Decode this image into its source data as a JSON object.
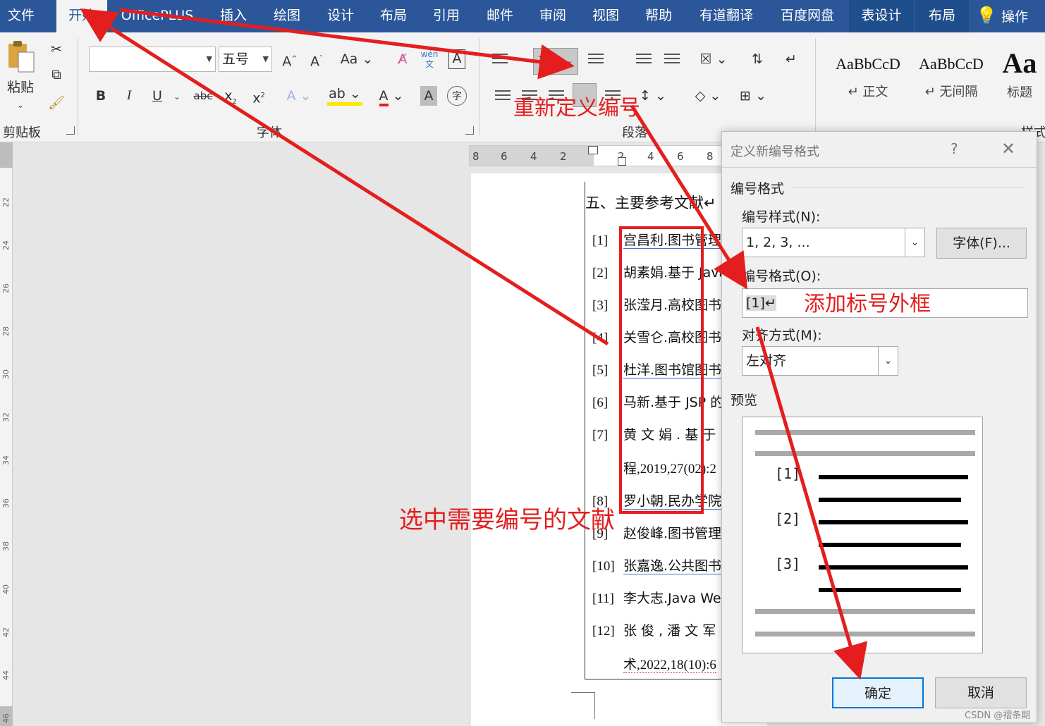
{
  "ribbon_tabs": [
    "文件",
    "开始",
    "OfficePLUS",
    "插入",
    "绘图",
    "设计",
    "布局",
    "引用",
    "邮件",
    "审阅",
    "视图",
    "帮助",
    "有道翻译",
    "百度网盘",
    "表设计",
    "布局",
    "操作"
  ],
  "clipboard": {
    "paste_label": "粘贴",
    "group_label": "剪贴板"
  },
  "font": {
    "font_name": "",
    "font_size": "五号",
    "group_label": "字体"
  },
  "paragraph": {
    "group_label": "段落"
  },
  "styles": {
    "items": [
      {
        "sample": "AaBbCcD",
        "name": "↵ 正文"
      },
      {
        "sample": "AaBbCcD",
        "name": "↵ 无间隔"
      },
      {
        "sample": "Aa",
        "name": "标题"
      }
    ],
    "group_label": "样式"
  },
  "vertical_ruler_ticks": [
    "22",
    "24",
    "26",
    "28",
    "30",
    "32",
    "34",
    "36",
    "38",
    "40",
    "42",
    "44",
    "46"
  ],
  "horizontal_ruler_ticks": [
    "8",
    "6",
    "4",
    "2",
    "2",
    "4",
    "6",
    "8"
  ],
  "document": {
    "heading": "五、主要参考文献↵",
    "references": [
      {
        "num": "[1]",
        "text": "宫昌利.图书管理"
      },
      {
        "num": "[2]",
        "text": "胡素娟.基于 Java"
      },
      {
        "num": "[3]",
        "text": "张滢月.高校图书"
      },
      {
        "num": "[4]",
        "text": "关雪仑.高校图书"
      },
      {
        "num": "[5]",
        "text": "杜洋.图书馆图书"
      },
      {
        "num": "[6]",
        "text": "马新.基于 JSP 的"
      },
      {
        "num": "[7]",
        "text": "黄 文 娟 . 基 于"
      },
      {
        "num": "[8]",
        "text": "罗小朝.民办学院"
      },
      {
        "num": "[9]",
        "text": "赵俊峰.图书管理"
      },
      {
        "num": "[10]",
        "text": "张嘉逸.公共图书"
      },
      {
        "num": "[11]",
        "text": "李大志.Java Web"
      },
      {
        "num": "[12]",
        "text": "张 俊 , 潘 文 军"
      }
    ],
    "continuation_7": "程,2019,27(02):2",
    "continuation_12": "术,2022,18(10):6"
  },
  "dialog": {
    "title": "定义新编号格式",
    "help": "?",
    "close": "✕",
    "section_label": "编号格式",
    "style_label": "编号样式(N):",
    "style_value": "1, 2, 3, ...",
    "font_button": "字体(F)...",
    "format_label": "编号格式(O):",
    "format_value": "[1]↵",
    "align_label": "对齐方式(M):",
    "align_value": "左对齐",
    "preview_label": "预览",
    "preview_numbers": [
      "[1]",
      "[2]",
      "[3]"
    ],
    "ok_button": "确定",
    "cancel_button": "取消"
  },
  "annotations": {
    "redefine_numbering": "重新定义编号",
    "add_bracket": "添加标号外框",
    "select_references": "选中需要编号的文献",
    "annotation_color": "#e41e1e"
  },
  "watermark": "CSDN @褶条期"
}
